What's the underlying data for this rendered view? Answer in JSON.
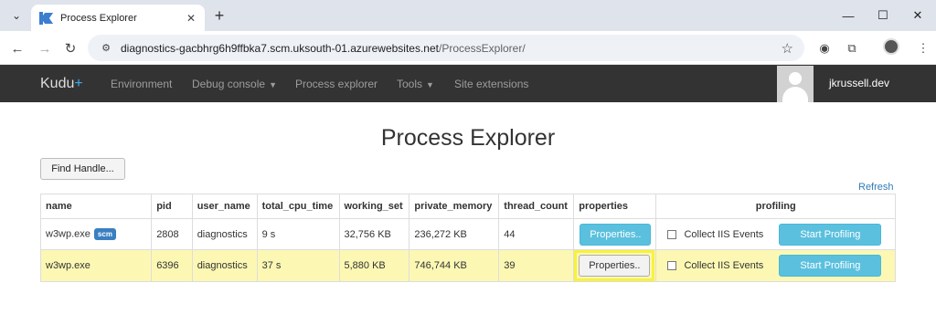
{
  "browser": {
    "tab_title": "Process Explorer",
    "url_host": "diagnostics-gacbhrg6h9ffbka7.scm.uksouth-01.azurewebsites.net",
    "url_path": "/ProcessExplorer/"
  },
  "kudu_nav": {
    "brand": "Kudu",
    "brand_plus": "+",
    "links": [
      "Environment",
      "Debug console",
      "Process explorer",
      "Tools",
      "Site extensions"
    ],
    "user": "jkrussell.dev"
  },
  "page": {
    "title": "Process Explorer",
    "find_handle_label": "Find Handle...",
    "refresh_label": "Refresh"
  },
  "table": {
    "headers": [
      "name",
      "pid",
      "user_name",
      "total_cpu_time",
      "working_set",
      "private_memory",
      "thread_count",
      "properties",
      "profiling"
    ],
    "rows": [
      {
        "name": "w3wp.exe",
        "badge": "scm",
        "pid": "2808",
        "user_name": "diagnostics",
        "total_cpu_time": "9 s",
        "working_set": "32,756 KB",
        "private_memory": "236,272 KB",
        "thread_count": "44",
        "properties_label": "Properties..",
        "collect_label": "Collect IIS Events",
        "profile_label": "Start Profiling"
      },
      {
        "name": "w3wp.exe",
        "pid": "6396",
        "user_name": "diagnostics",
        "total_cpu_time": "37 s",
        "working_set": "5,880 KB",
        "private_memory": "746,744 KB",
        "thread_count": "39",
        "properties_label": "Properties..",
        "collect_label": "Collect IIS Events",
        "profile_label": "Start Profiling"
      }
    ]
  },
  "colors": {
    "nav_bg": "#333333",
    "highlight_row": "#fcf8b4",
    "callout_frame": "#f7f23c",
    "info_button": "#5bc0de"
  }
}
